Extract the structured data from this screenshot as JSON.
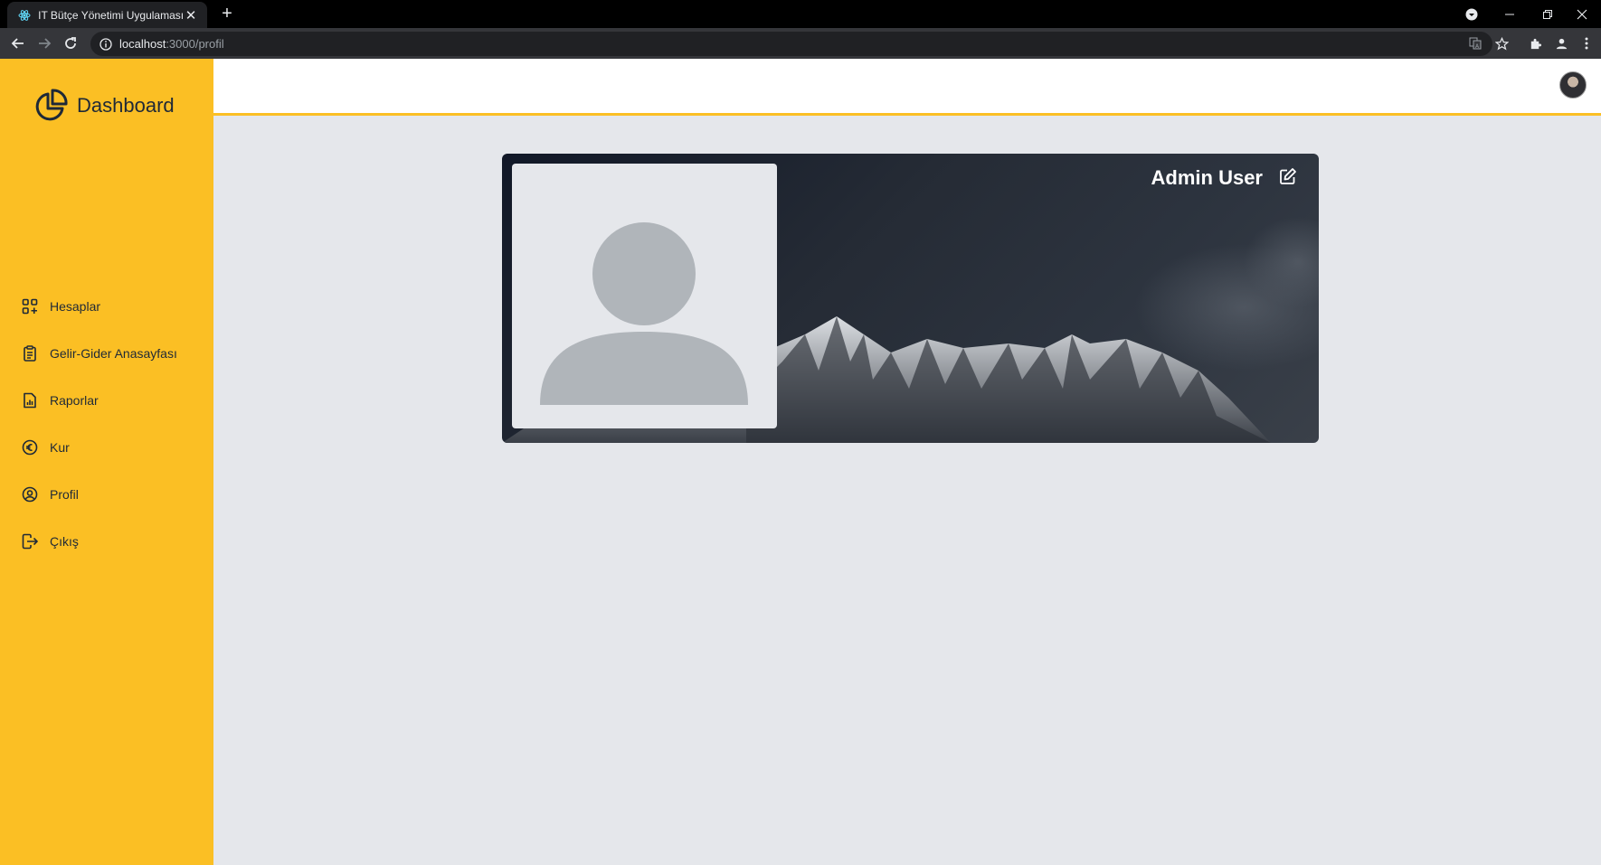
{
  "browser": {
    "tab_title": "IT Bütçe Yönetimi Uygulaması",
    "url_host": "localhost",
    "url_path": ":3000/profil"
  },
  "app": {
    "brand": "Dashboard",
    "nav": [
      {
        "label": "Hesaplar",
        "icon": "grid-plus-icon"
      },
      {
        "label": "Gelir-Gider Anasayfası",
        "icon": "clipboard-icon"
      },
      {
        "label": "Raporlar",
        "icon": "report-chart-icon"
      },
      {
        "label": "Kur",
        "icon": "euro-circle-icon"
      },
      {
        "label": "Profil",
        "icon": "user-circle-icon"
      },
      {
        "label": "Çıkış",
        "icon": "logout-icon"
      }
    ],
    "accent_color": "#fbbf24",
    "profile": {
      "name": "Admin User"
    }
  }
}
